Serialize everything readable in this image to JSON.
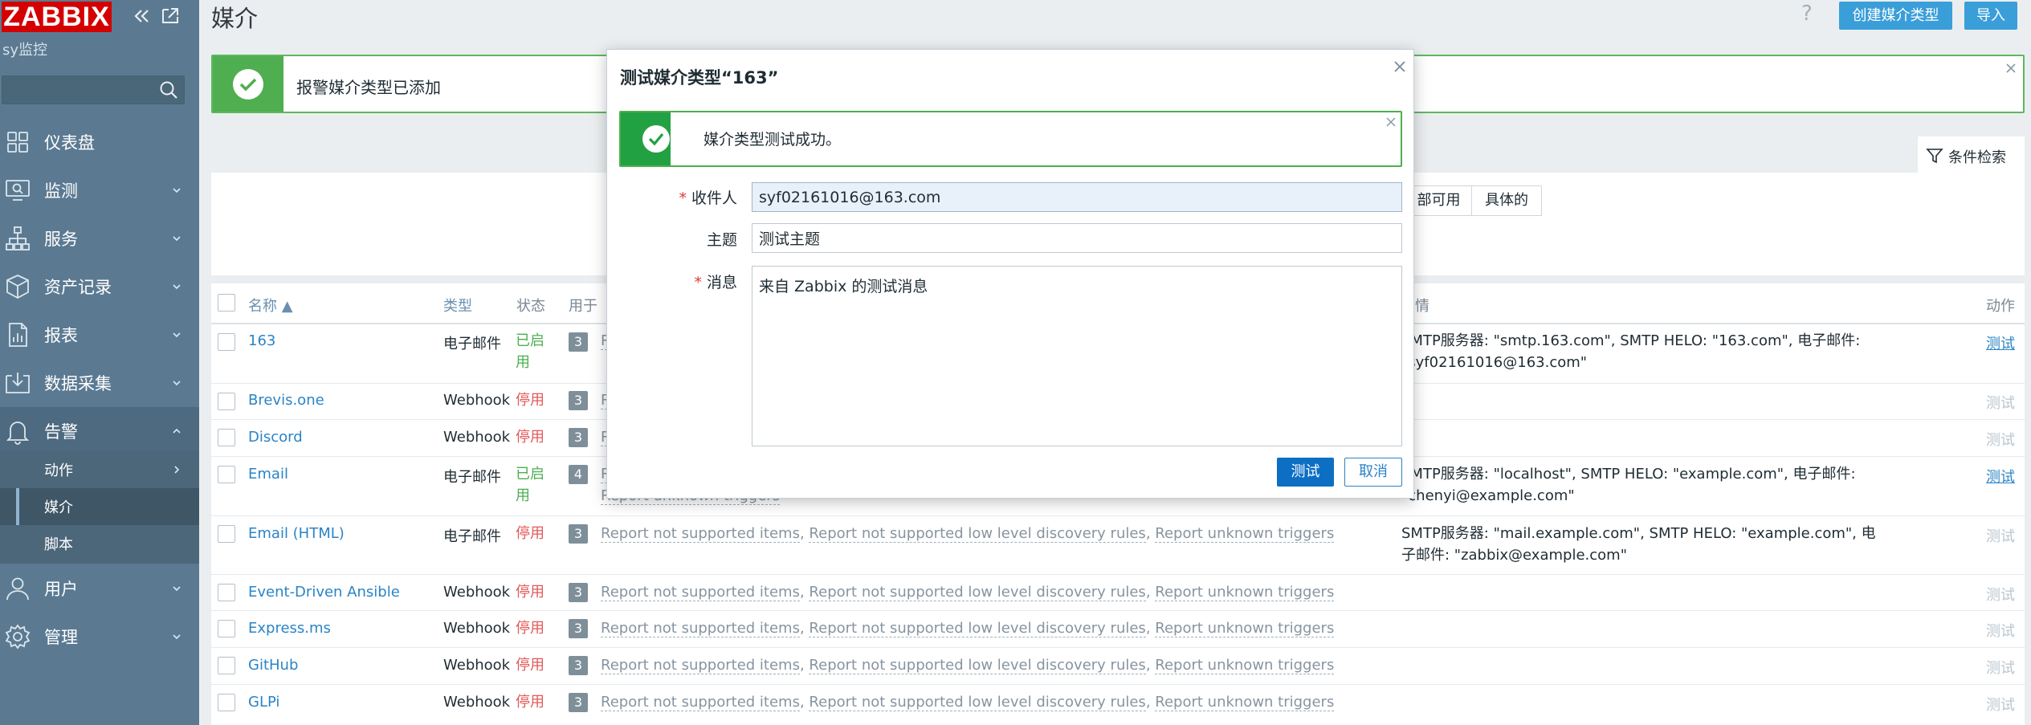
{
  "sidebar": {
    "logo": "ZABBIX",
    "subtitle": "sy监控",
    "search_placeholder": "",
    "items": [
      {
        "label": "仪表盘",
        "icon": "dashboard-icon"
      },
      {
        "label": "监测",
        "icon": "monitoring-icon"
      },
      {
        "label": "服务",
        "icon": "services-icon"
      },
      {
        "label": "资产记录",
        "icon": "inventory-icon"
      },
      {
        "label": "报表",
        "icon": "reports-icon"
      },
      {
        "label": "数据采集",
        "icon": "data-collection-icon"
      },
      {
        "label": "告警",
        "icon": "alerts-bell-icon"
      },
      {
        "label": "用户",
        "icon": "users-icon"
      },
      {
        "label": "管理",
        "icon": "administration-gear-icon"
      }
    ],
    "alerts_submenu": [
      {
        "label": "动作"
      },
      {
        "label": "媒介"
      },
      {
        "label": "脚本"
      }
    ]
  },
  "header": {
    "title": "媒介",
    "create_button": "创建媒介类型",
    "import_button": "导入"
  },
  "message": {
    "text": "报警媒介类型已添加"
  },
  "filter": {
    "tab_label": "条件检索",
    "seg_partial": "部可用",
    "seg_specific": "具体的"
  },
  "table": {
    "headers": {
      "name": "名称 ▲",
      "type": "类型",
      "status": "状态",
      "used": "用于",
      "detail": "情",
      "action": "动作"
    },
    "rows": [
      {
        "name": "163",
        "type": "电子邮件",
        "status": "已启用",
        "count": "3",
        "used": [
          "Re"
        ],
        "detail": "SMTP服务器: \"smtp.163.com\", SMTP HELO: \"163.com\", 电子邮件: \"syf02161016@163.com\"",
        "action": "测试"
      },
      {
        "name": "Brevis.one",
        "type": "Webhook",
        "status": "停用",
        "count": "3",
        "used": [
          "Re"
        ],
        "detail": "",
        "action": "测试"
      },
      {
        "name": "Discord",
        "type": "Webhook",
        "status": "停用",
        "count": "3",
        "used": [
          "Re"
        ],
        "detail": "",
        "action": "测试"
      },
      {
        "name": "Email",
        "type": "电子邮件",
        "status": "已启用",
        "count": "4",
        "used": [
          "Re",
          "Report unknown triggers"
        ],
        "detail": "SMTP服务器: \"localhost\", SMTP HELO: \"example.com\", 电子邮件: \"chenyi@example.com\"",
        "action": "测试"
      },
      {
        "name": "Email (HTML)",
        "type": "电子邮件",
        "status": "停用",
        "count": "3",
        "used": [
          "Report not supported items",
          "Report not supported low level discovery rules",
          "Report unknown triggers"
        ],
        "detail": "SMTP服务器: \"mail.example.com\", SMTP HELO: \"example.com\", 电子邮件: \"zabbix@example.com\"",
        "action": "测试"
      },
      {
        "name": "Event-Driven Ansible",
        "type": "Webhook",
        "status": "停用",
        "count": "3",
        "used": [
          "Report not supported items",
          "Report not supported low level discovery rules",
          "Report unknown triggers"
        ],
        "detail": "",
        "action": "测试"
      },
      {
        "name": "Express.ms",
        "type": "Webhook",
        "status": "停用",
        "count": "3",
        "used": [
          "Report not supported items",
          "Report not supported low level discovery rules",
          "Report unknown triggers"
        ],
        "detail": "",
        "action": "测试"
      },
      {
        "name": "GitHub",
        "type": "Webhook",
        "status": "停用",
        "count": "3",
        "used": [
          "Report not supported items",
          "Report not supported low level discovery rules",
          "Report unknown triggers"
        ],
        "detail": "",
        "action": "测试"
      },
      {
        "name": "GLPi",
        "type": "Webhook",
        "status": "停用",
        "count": "3",
        "used": [
          "Report not supported items",
          "Report not supported low level discovery rules",
          "Report unknown triggers"
        ],
        "detail": "",
        "action": "测试"
      }
    ]
  },
  "dialog": {
    "title": "测试媒介类型“163”",
    "success_text": "媒介类型测试成功。",
    "recipient_label": "收件人",
    "recipient_value": "syf02161016@163.com",
    "subject_label": "主题",
    "subject_value": "测试主题",
    "message_label": "消息",
    "message_value": "来自 Zabbix 的测试消息",
    "test_button": "测试",
    "cancel_button": "取消"
  }
}
